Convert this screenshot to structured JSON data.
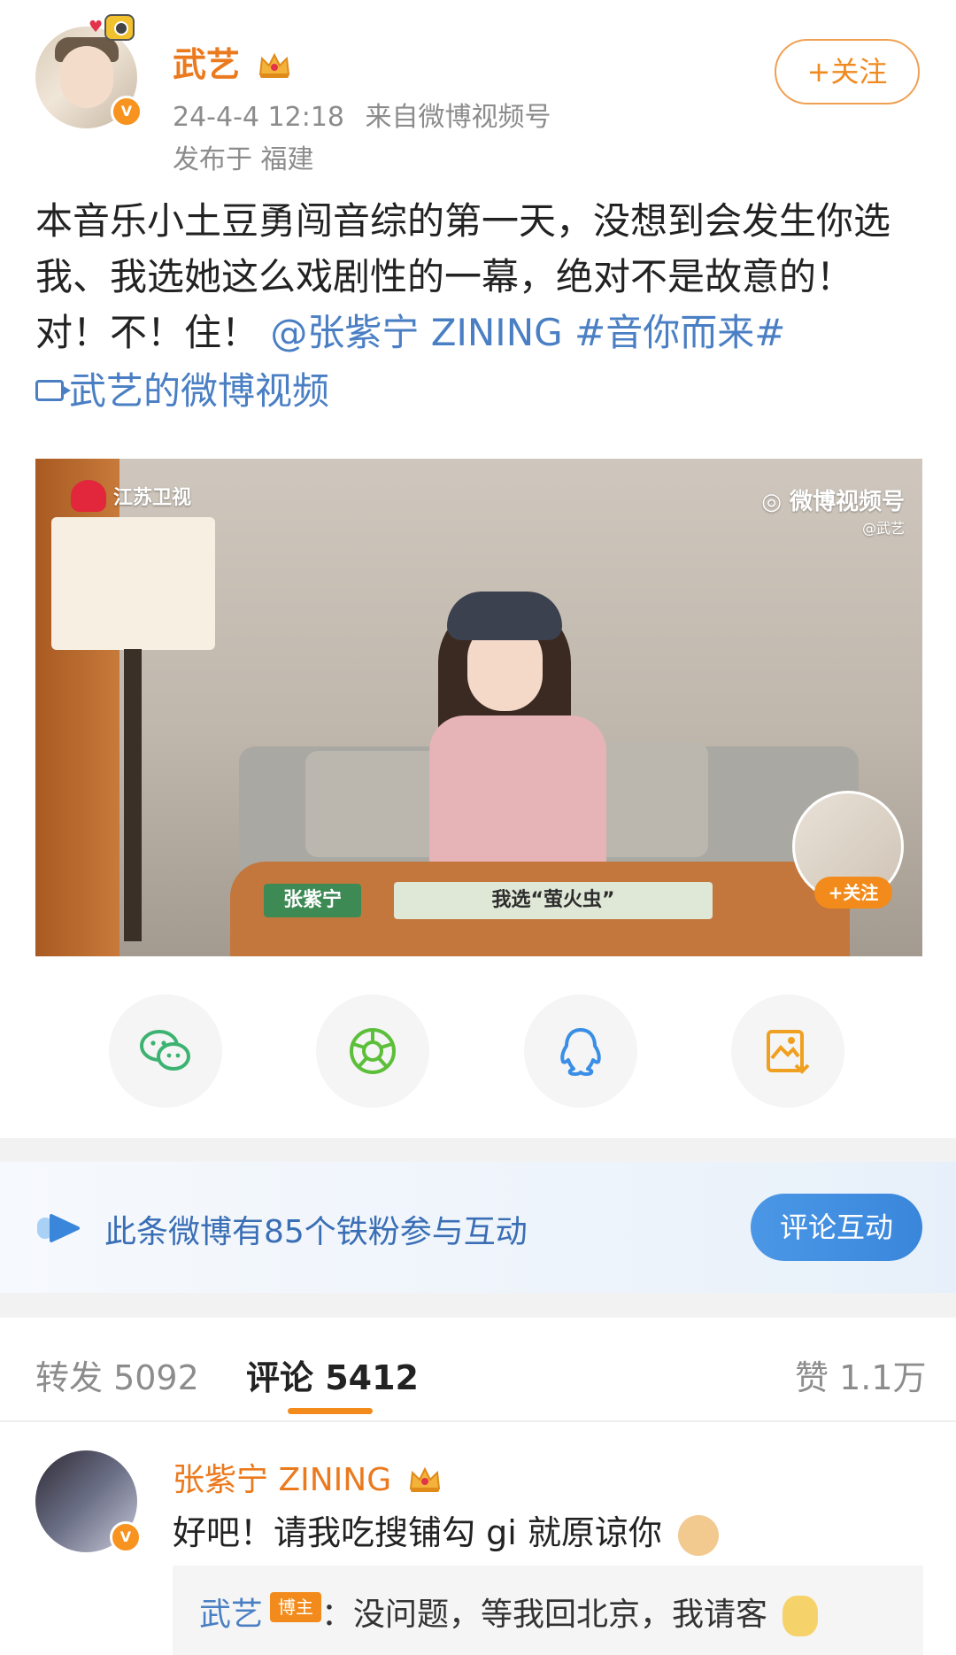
{
  "post": {
    "author": "武艺",
    "datetime": "24-4-4 12:18",
    "source": "来自微博视频号",
    "location": "发布于 福建",
    "follow_label": "+关注",
    "text_main": "本音乐小土豆勇闯音综的第一天，没想到会发生你选我、我选她这么戏剧性的一幕，绝对不是故意的！对！不！住！",
    "mention": "@张紫宁 ZINING",
    "hashtag": "#音你而来#",
    "video_link": "武艺的微博视频"
  },
  "video": {
    "tv_logo": "江苏卫视",
    "watermark_title": "微博视频号",
    "watermark_handle": "@武艺",
    "name_tag": "张紫宁",
    "caption": "我选“萤火虫”",
    "overlay_follow": "+关注"
  },
  "share_icons": [
    "wechat-icon",
    "moments-icon",
    "qq-icon",
    "save-image-icon"
  ],
  "colors": {
    "orange": "#f28b1b",
    "link_blue": "#4a7fc4",
    "wechat_green": "#3cb371",
    "qq_blue": "#3a8ee6",
    "save_orange": "#f0a020"
  },
  "fans_banner": {
    "text": "此条微博有85个铁粉参与互动",
    "button": "评论互动"
  },
  "tabs": {
    "repost": "转发 5092",
    "comment": "评论 5412",
    "like": "赞 1.1万"
  },
  "comment": {
    "author": "张紫宁 ZINING",
    "text": "好吧！请我吃搜铺勾 gi 就原谅你",
    "reply_author": "武艺",
    "reply_badge": "博主",
    "reply_text": "：没问题，等我回北京，我请客"
  }
}
